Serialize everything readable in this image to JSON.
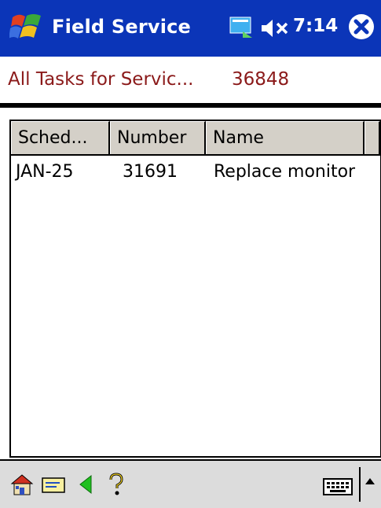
{
  "titlebar": {
    "title": "Field Service",
    "time": "7:14",
    "icons": [
      "windows-start-icon",
      "connectivity-icon",
      "speaker-muted-icon",
      "close-icon"
    ]
  },
  "header": {
    "label": "All Tasks for Servic...",
    "value": "36848"
  },
  "table": {
    "columns": [
      "Sched...",
      "Number",
      "Name"
    ],
    "rows": [
      {
        "sched": "JAN-25",
        "number": "31691",
        "name": "Replace monitor"
      }
    ]
  },
  "toolbar": {
    "icons": [
      "home-icon",
      "message-icon",
      "back-arrow-icon",
      "help-icon",
      "keyboard-icon",
      "sip-up-arrow-icon"
    ]
  },
  "colors": {
    "titlebar": "#0b35b8",
    "header_text": "#8b1a1a",
    "column_header_bg": "#d4d0c8"
  }
}
